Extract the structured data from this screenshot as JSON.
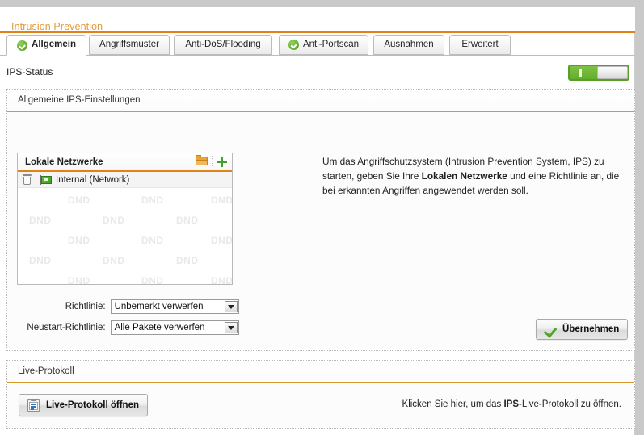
{
  "page": {
    "title": "Intrusion Prevention"
  },
  "tabs": [
    {
      "label": "Allgemein",
      "icon": "green-check-icon",
      "active": true,
      "checked": true
    },
    {
      "label": "Angriffsmuster",
      "icon": "",
      "active": false,
      "checked": false
    },
    {
      "label": "Anti-DoS/Flooding",
      "icon": "",
      "active": false,
      "checked": false
    },
    {
      "label": "Anti-Portscan",
      "icon": "green-check-icon",
      "active": false,
      "checked": true
    },
    {
      "label": "Ausnahmen",
      "icon": "",
      "active": false,
      "checked": false
    },
    {
      "label": "Erweitert",
      "icon": "",
      "active": false,
      "checked": false
    }
  ],
  "status": {
    "label": "IPS-Status",
    "toggle_state": "on"
  },
  "general_panel": {
    "header": "Allgemeine IPS-Einstellungen",
    "networks_box": {
      "title": "Lokale Netzwerke",
      "folder_icon": "folder-icon",
      "add_icon": "plus-icon",
      "rows": [
        {
          "delete_icon": "trash-icon",
          "type_icon": "network-icon",
          "label": "Internal (Network)"
        }
      ],
      "watermark": "DND"
    },
    "hint_before": "Um das Angriffschutzsystem (Intrusion Prevention System, IPS) zu starten, geben Sie Ihre ",
    "hint_bold": "Lokalen Netzwerke",
    "hint_after": " und eine Richtlinie an, die bei erkannten Angriffen angewendet werden soll.",
    "fields": [
      {
        "label": "Richtlinie:",
        "value": "Unbemerkt verwerfen"
      },
      {
        "label": "Neustart-Richtlinie:",
        "value": "Alle Pakete verwerfen"
      }
    ],
    "apply_button": "Übernehmen"
  },
  "log_panel": {
    "header": "Live-Protokoll",
    "open_button": "Live-Protokoll öffnen",
    "hint_before": "Klicken Sie hier, um das ",
    "hint_bold": "IPS",
    "hint_after": "-Live-Protokoll zu öffnen."
  },
  "colors": {
    "accent_orange": "#e08214",
    "title_orange": "#e49a38",
    "green": "#5faa27"
  }
}
